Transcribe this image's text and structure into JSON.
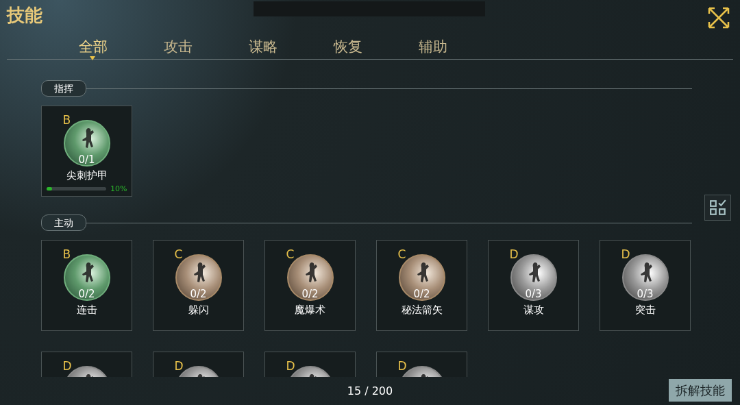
{
  "title": "技能",
  "tabs": [
    {
      "label": "全部",
      "selected": true
    },
    {
      "label": "攻击",
      "selected": false
    },
    {
      "label": "谋略",
      "selected": false
    },
    {
      "label": "恢复",
      "selected": false
    },
    {
      "label": "辅助",
      "selected": false
    }
  ],
  "sections": [
    {
      "label": "指挥",
      "skills": [
        {
          "grade": "B",
          "count": "0/1",
          "name": "尖刺护甲",
          "progress": {
            "level": 0.1,
            "reading": "10%"
          }
        }
      ]
    },
    {
      "label": "主动",
      "skills": [
        {
          "grade": "B",
          "count": "0/2",
          "name": "连击"
        },
        {
          "grade": "C",
          "count": "0/2",
          "name": "躲闪"
        },
        {
          "grade": "C",
          "count": "0/2",
          "name": "魔爆术"
        },
        {
          "grade": "C",
          "count": "0/2",
          "name": "秘法箭矢"
        },
        {
          "grade": "D",
          "count": "0/3",
          "name": "谋攻"
        },
        {
          "grade": "D",
          "count": "0/3",
          "name": "突击"
        },
        {
          "grade": "D"
        },
        {
          "grade": "D"
        },
        {
          "grade": "D"
        },
        {
          "grade": "D"
        }
      ]
    }
  ],
  "footer": {
    "count": "15 / 200",
    "button": "拆解技能"
  }
}
